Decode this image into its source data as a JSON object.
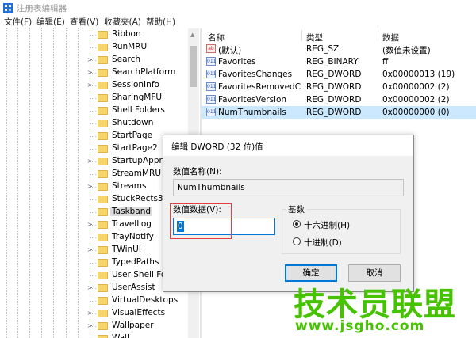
{
  "window": {
    "title": "注册表编辑器"
  },
  "menu": [
    "文件(F)",
    "编辑(E)",
    "查看(V)",
    "收藏夹(A)",
    "帮助(H)"
  ],
  "tree": {
    "items": [
      {
        "label": "Ribbon",
        "expandable": false
      },
      {
        "label": "RunMRU",
        "expandable": false
      },
      {
        "label": "Search",
        "expandable": true
      },
      {
        "label": "SearchPlatform",
        "expandable": true
      },
      {
        "label": "SessionInfo",
        "expandable": true
      },
      {
        "label": "SharingMFU",
        "expandable": false
      },
      {
        "label": "Shell Folders",
        "expandable": false
      },
      {
        "label": "Shutdown",
        "expandable": false
      },
      {
        "label": "StartPage",
        "expandable": false
      },
      {
        "label": "StartPage2",
        "expandable": false
      },
      {
        "label": "StartupApprov",
        "expandable": true
      },
      {
        "label": "StreamMRU",
        "expandable": false
      },
      {
        "label": "Streams",
        "expandable": true
      },
      {
        "label": "StuckRects3",
        "expandable": false
      },
      {
        "label": "Taskband",
        "expandable": false,
        "selected": true
      },
      {
        "label": "TravelLog",
        "expandable": true
      },
      {
        "label": "TrayNotify",
        "expandable": false
      },
      {
        "label": "TWinUI",
        "expandable": true
      },
      {
        "label": "TypedPaths",
        "expandable": false
      },
      {
        "label": "User Shell Fold",
        "expandable": false
      },
      {
        "label": "UserAssist",
        "expandable": true
      },
      {
        "label": "VirtualDesktops",
        "expandable": false
      },
      {
        "label": "VisualEffects",
        "expandable": true
      },
      {
        "label": "Wallpaper",
        "expandable": true
      },
      {
        "label": "Wall",
        "expandable": false
      }
    ]
  },
  "list": {
    "headers": {
      "name": "名称",
      "type": "类型",
      "data": "数据"
    },
    "rows": [
      {
        "name": "(默认)",
        "type": "REG_SZ",
        "data": "(数值未设置)",
        "icon": "string-value-icon"
      },
      {
        "name": "Favorites",
        "type": "REG_BINARY",
        "data": "ff",
        "icon": "binary-value-icon"
      },
      {
        "name": "FavoritesChanges",
        "type": "REG_DWORD",
        "data": "0x00000013 (19)",
        "icon": "binary-value-icon"
      },
      {
        "name": "FavoritesRemovedC...",
        "type": "REG_DWORD",
        "data": "0x00000002 (2)",
        "icon": "binary-value-icon"
      },
      {
        "name": "FavoritesVersion",
        "type": "REG_DWORD",
        "data": "0x00000002 (2)",
        "icon": "binary-value-icon"
      },
      {
        "name": "NumThumbnails",
        "type": "REG_DWORD",
        "data": "0x00000000 (0)",
        "icon": "binary-value-icon",
        "selected": true
      }
    ]
  },
  "dialog": {
    "title": "编辑 DWORD (32 位)值",
    "value_name_label": "数值名称(N):",
    "value_name": "NumThumbnails",
    "value_data_label": "数值数据(V):",
    "value_data": "0",
    "base_label": "基数",
    "base_options": [
      {
        "label": "十六进制(H)",
        "checked": true
      },
      {
        "label": "十进制(D)",
        "checked": false
      }
    ],
    "ok_label": "确定",
    "cancel_label": "取消"
  },
  "watermark": {
    "text": "技术员联盟",
    "url": "www.jsgho.com"
  },
  "colors": {
    "accent": "#0078d7",
    "selection": "#cce8ff",
    "highlight_box": "#e04040",
    "watermark": "#46c300"
  }
}
